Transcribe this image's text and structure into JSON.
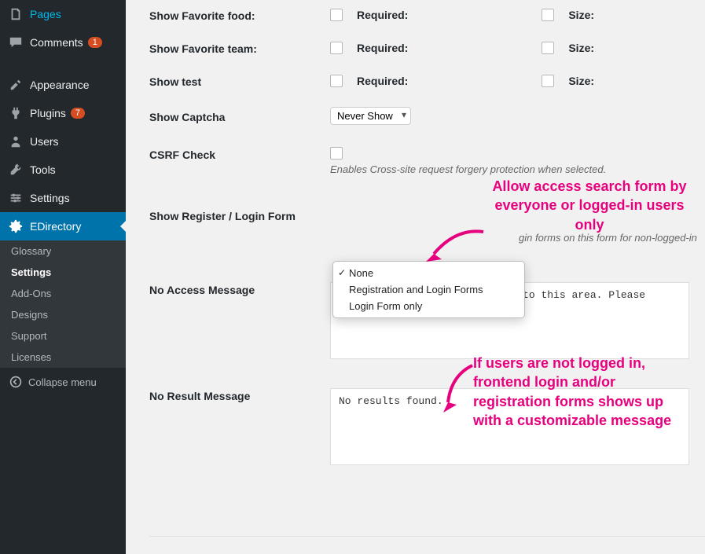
{
  "sidebar": {
    "items": [
      {
        "label": "Pages",
        "icon": "pages"
      },
      {
        "label": "Comments",
        "icon": "comments",
        "badge": "1"
      },
      {
        "label": "Appearance",
        "icon": "appearance"
      },
      {
        "label": "Plugins",
        "icon": "plugins",
        "badge": "7"
      },
      {
        "label": "Users",
        "icon": "users"
      },
      {
        "label": "Tools",
        "icon": "tools"
      },
      {
        "label": "Settings",
        "icon": "settings"
      },
      {
        "label": "EDirectory",
        "icon": "gear",
        "active": true
      }
    ],
    "submenu": [
      {
        "label": "Glossary"
      },
      {
        "label": "Settings",
        "current": true
      },
      {
        "label": "Add-Ons"
      },
      {
        "label": "Designs"
      },
      {
        "label": "Support"
      },
      {
        "label": "Licenses"
      }
    ],
    "collapse_label": "Collapse menu"
  },
  "form": {
    "rows": [
      {
        "label": "Show Favorite food:",
        "check1": "Required:",
        "check2": "Size:"
      },
      {
        "label": "Show Favorite team:",
        "check1": "Required:",
        "check2": "Size:"
      },
      {
        "label": "Show test",
        "check1": "Required:",
        "check2": "Size:"
      }
    ],
    "captcha_label": "Show Captcha",
    "captcha_value": "Never Show",
    "csrf_label": "CSRF Check",
    "csrf_helper": "Enables Cross-site request forgery protection when selected.",
    "register_label": "Show Register / Login Form",
    "register_helper": "gin forms on this form for non-logged-in",
    "dropdown_options": [
      {
        "label": "None",
        "selected": true
      },
      {
        "label": "Registration and Login Forms"
      },
      {
        "label": "Login Form only"
      }
    ],
    "no_access_label": "No Access Message",
    "no_access_value": "You are not allowed to access to this area. Please conta site administrator.",
    "no_result_label": "No Result Message",
    "no_result_value": "No results found."
  },
  "annotations": {
    "top": "Allow access search form by everyone or logged-in users only",
    "bottom": "If users are not logged in, frontend login and/or registration forms shows up with a customizable message"
  }
}
